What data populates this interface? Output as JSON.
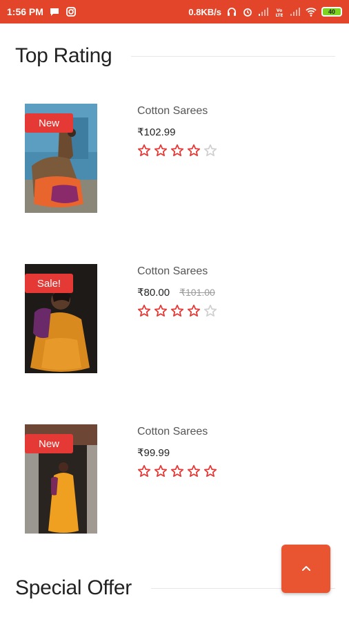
{
  "status_bar": {
    "time": "1:56 PM",
    "network_speed": "0.8KB/s",
    "battery_level": "40",
    "icons": [
      "chat-icon",
      "instagram-icon",
      "headset-icon",
      "alarm-icon",
      "signal-icon",
      "volte-icon",
      "signal-icon",
      "wifi-icon"
    ]
  },
  "sections": {
    "top_rating": {
      "title": "Top Rating"
    },
    "special_offer": {
      "title": "Special Offer"
    }
  },
  "products": [
    {
      "name": "Cotton Sarees",
      "price": "₹102.99",
      "old_price": "",
      "badge": "New",
      "rating": 4,
      "rating_max": 5
    },
    {
      "name": "Cotton Sarees",
      "price": "₹80.00",
      "old_price": "₹101.00",
      "badge": "Sale!",
      "rating": 4,
      "rating_max": 5
    },
    {
      "name": "Cotton Sarees",
      "price": "₹99.99",
      "old_price": "",
      "badge": "New",
      "rating": 5,
      "rating_max": 5
    }
  ],
  "colors": {
    "accent": "#e2452a",
    "badge": "#e53935",
    "star_filled": "#e53935",
    "star_empty": "#d0d0d0"
  },
  "scroll_top": {
    "icon": "chevron-up-icon"
  }
}
